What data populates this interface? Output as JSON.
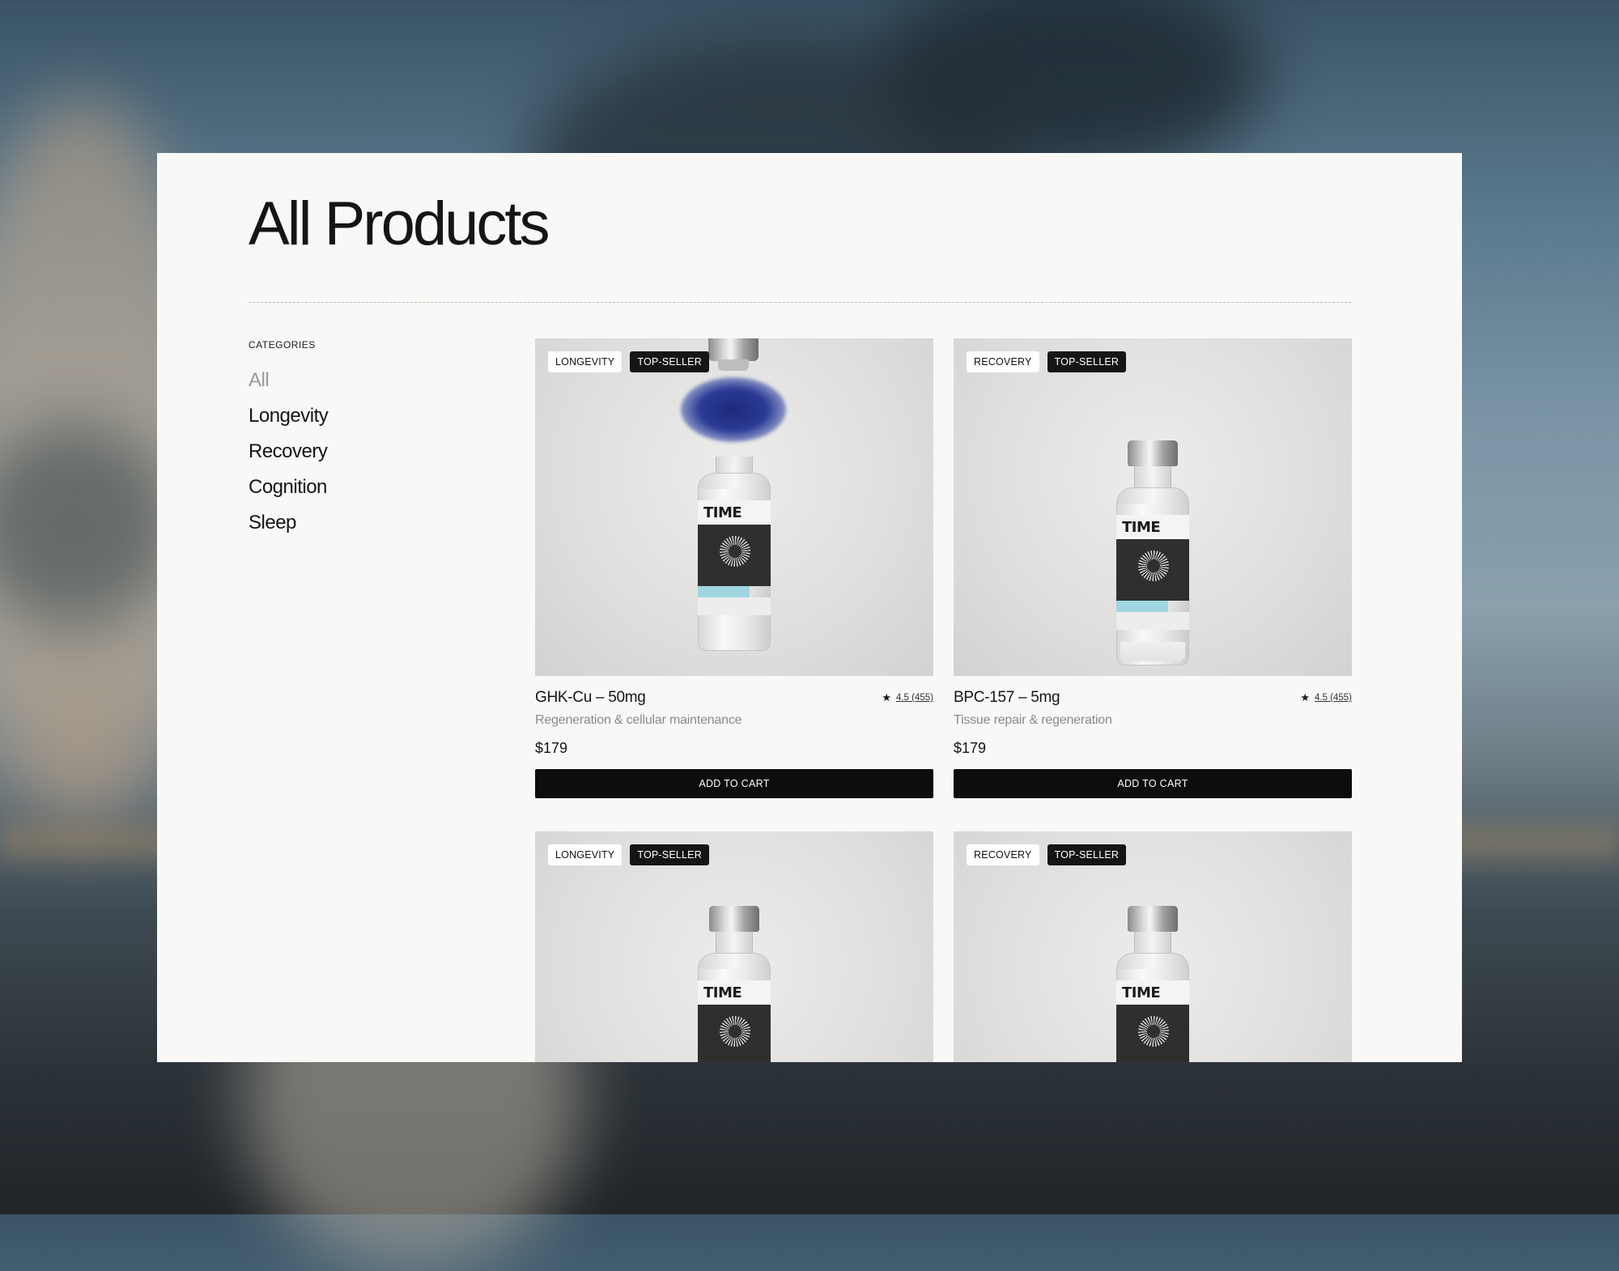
{
  "page": {
    "title": "All Products"
  },
  "sidebar": {
    "heading": "CATEGORIES",
    "items": [
      {
        "label": "All",
        "active": true
      },
      {
        "label": "Longevity",
        "active": false
      },
      {
        "label": "Recovery",
        "active": false
      },
      {
        "label": "Cognition",
        "active": false
      },
      {
        "label": "Sleep",
        "active": false
      }
    ]
  },
  "products": [
    {
      "category_badge": "LONGEVITY",
      "seller_badge": "TOP-SELLER",
      "name": "GHK-Cu – 50mg",
      "rating": "4.5 (455)",
      "description": "Regeneration & cellular maintenance",
      "price": "$179",
      "button": "ADD TO CART",
      "vial_brand": "TIME"
    },
    {
      "category_badge": "RECOVERY",
      "seller_badge": "TOP-SELLER",
      "name": "BPC-157 – 5mg",
      "rating": "4.5 (455)",
      "description": "Tissue repair & regeneration",
      "price": "$179",
      "button": "ADD TO CART",
      "vial_brand": "TIME"
    },
    {
      "category_badge": "LONGEVITY",
      "seller_badge": "TOP-SELLER",
      "vial_brand": "TIME"
    },
    {
      "category_badge": "RECOVERY",
      "seller_badge": "TOP-SELLER",
      "vial_brand": "TIME"
    }
  ],
  "icons": {
    "rating": "star-icon"
  },
  "colors": {
    "panel": "#f8f8f6",
    "button": "#0d0d0d",
    "badge_dark": "#151515",
    "vial_accent": "#9fd6e0"
  }
}
